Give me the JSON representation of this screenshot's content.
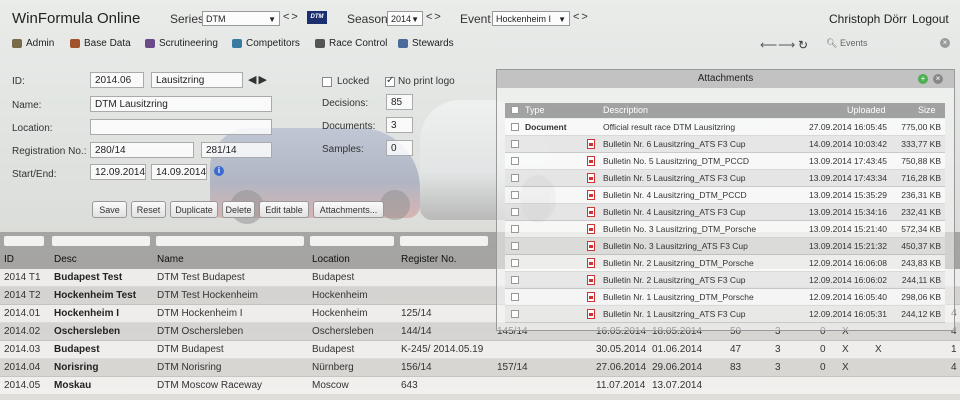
{
  "app": {
    "title": "WinFormula Online"
  },
  "header": {
    "series_label": "Series",
    "series_value": "DTM",
    "season_label": "Season",
    "season_value": "2014",
    "event_label": "Event",
    "event_value": "Hockenheim I",
    "logo_text": "DTM",
    "user": "Christoph Dörr",
    "logout": "Logout"
  },
  "menu": [
    {
      "label": "Admin",
      "icon": "admin-icon",
      "color": "#7a6a4a"
    },
    {
      "label": "Base Data",
      "icon": "base-data-icon",
      "color": "#a0522d"
    },
    {
      "label": "Scrutineering",
      "icon": "scrutineering-icon",
      "color": "#6a4a8a"
    },
    {
      "label": "Competitors",
      "icon": "competitors-icon",
      "color": "#3a7aa0"
    },
    {
      "label": "Race Control",
      "icon": "race-control-icon",
      "color": "#555555"
    },
    {
      "label": "Stewards",
      "icon": "stewards-icon",
      "color": "#4a6a9a"
    }
  ],
  "search": {
    "placeholder": "Events"
  },
  "form": {
    "id_label": "ID:",
    "id_value": "2014.06",
    "id_name": "Lausitzring",
    "name_label": "Name:",
    "name_value": "DTM Lausitzring",
    "location_label": "Location:",
    "location_value": "",
    "regno_label": "Registration No.:",
    "regno_value": "280/14",
    "regno_value2": "281/14",
    "startend_label": "Start/End:",
    "start_value": "12.09.2014",
    "end_value": "14.09.2014",
    "locked_label": "Locked",
    "noprint_label": "No print logo",
    "decisions_label": "Decisions:",
    "decisions_value": "85",
    "documents_label": "Documents:",
    "documents_value": "3",
    "samples_label": "Samples:",
    "samples_value": "0"
  },
  "buttons": {
    "save": "Save",
    "reset": "Reset",
    "duplicate": "Duplicate",
    "delete": "Delete",
    "edit_table": "Edit table",
    "attachments": "Attachments..."
  },
  "table": {
    "headers": [
      "ID",
      "Desc",
      "Name",
      "Location",
      "Register No."
    ],
    "rows": [
      {
        "id": "2014 T1",
        "desc": "Budapest Test",
        "name": "DTM Test Budapest",
        "location": "Budapest",
        "reg": "",
        "reg2": "",
        "start": "",
        "end": "",
        "n1": "",
        "n2": "",
        "n3": "",
        "x1": "",
        "x2": "",
        "last": ""
      },
      {
        "id": "2014 T2",
        "desc": "Hockenheim Test",
        "name": "DTM Test Hockenheim",
        "location": "Hockenheim",
        "reg": "",
        "reg2": "",
        "start": "",
        "end": "",
        "n1": "",
        "n2": "",
        "n3": "",
        "x1": "",
        "x2": "",
        "last": ""
      },
      {
        "id": "2014.01",
        "desc": "Hockenheim I",
        "name": "DTM Hockenheim I",
        "location": "Hockenheim",
        "reg": "125/14",
        "reg2": "",
        "start": "",
        "end": "",
        "n1": "",
        "n2": "",
        "n3": "",
        "x1": "",
        "x2": "",
        "last": "4"
      },
      {
        "id": "2014.02",
        "desc": "Oschersleben",
        "name": "DTM Oschersleben",
        "location": "Oschersleben",
        "reg": "144/14",
        "reg2": "145/14",
        "start": "16.05.2014",
        "end": "18.05.2014",
        "n1": "50",
        "n2": "3",
        "n3": "0",
        "x1": "X",
        "x2": "",
        "last": "4"
      },
      {
        "id": "2014.03",
        "desc": "Budapest",
        "name": "DTM Budapest",
        "location": "Budapest",
        "reg": "K-245/ 2014.05.19",
        "reg2": "",
        "start": "30.05.2014",
        "end": "01.06.2014",
        "n1": "47",
        "n2": "3",
        "n3": "0",
        "x1": "X",
        "x2": "X",
        "last": "1"
      },
      {
        "id": "2014.04",
        "desc": "Norisring",
        "name": "DTM Norisring",
        "location": "Nürnberg",
        "reg": "156/14",
        "reg2": "157/14",
        "start": "27.06.2014",
        "end": "29.06.2014",
        "n1": "83",
        "n2": "3",
        "n3": "0",
        "x1": "X",
        "x2": "",
        "last": "4"
      },
      {
        "id": "2014.05",
        "desc": "Moskau",
        "name": "DTM Moscow Raceway",
        "location": "Moscow",
        "reg": "643",
        "reg2": "",
        "start": "11.07.2014",
        "end": "13.07.2014",
        "n1": "",
        "n2": "",
        "n3": "",
        "x1": "",
        "x2": "",
        "last": ""
      }
    ]
  },
  "attachments": {
    "title": "Attachments",
    "headers": [
      "Type",
      "Description",
      "Uploaded",
      "Size"
    ],
    "rows": [
      {
        "type": "Document",
        "desc": "Official result race DTM Lausitzring",
        "date": "27.09.2014 16:05:45",
        "size": "775,00 KB",
        "pdf": false
      },
      {
        "type": "",
        "desc": "Bulletin Nr. 6 Lausitzring_ATS F3 Cup",
        "date": "14.09.2014 10:03:42",
        "size": "333,77 KB",
        "pdf": true
      },
      {
        "type": "",
        "desc": "Bulletin No. 5 Lausitzring_DTM_PCCD",
        "date": "13.09.2014 17:43:45",
        "size": "750,88 KB",
        "pdf": true
      },
      {
        "type": "",
        "desc": "Bulletin Nr. 5 Lausitzring_ATS F3 Cup",
        "date": "13.09.2014 17:43:34",
        "size": "716,28 KB",
        "pdf": true
      },
      {
        "type": "",
        "desc": "Bulletin Nr. 4 Lausitzring_DTM_PCCD",
        "date": "13.09.2014 15:35:29",
        "size": "236,31 KB",
        "pdf": true
      },
      {
        "type": "",
        "desc": "Bulletin Nr. 4 Lausitzring_ATS F3 Cup",
        "date": "13.09.2014 15:34:16",
        "size": "232,41 KB",
        "pdf": true
      },
      {
        "type": "",
        "desc": "Bulletin No. 3 Lausitzring_DTM_Porsche",
        "date": "13.09.2014 15:21:40",
        "size": "572,34 KB",
        "pdf": true
      },
      {
        "type": "",
        "desc": "Bulletin No. 3 Lausitzring_ATS F3 Cup",
        "date": "13.09.2014 15:21:32",
        "size": "450,37 KB",
        "pdf": true
      },
      {
        "type": "",
        "desc": "Bulletin Nr. 2 Lausitzring_DTM_Porsche",
        "date": "12.09.2014 16:06:08",
        "size": "243,83 KB",
        "pdf": true
      },
      {
        "type": "",
        "desc": "Bulletin Nr. 2 Lausitzring_ATS F3 Cup",
        "date": "12.09.2014 16:06:02",
        "size": "244,11 KB",
        "pdf": true
      },
      {
        "type": "",
        "desc": "Bulletin Nr. 1 Lausitzring_DTM_Porsche",
        "date": "12.09.2014 16:05:40",
        "size": "298,06 KB",
        "pdf": true
      },
      {
        "type": "",
        "desc": "Bulletin Nr. 1 Lausitzring_ATS F3 Cup",
        "date": "12.09.2014 16:05:31",
        "size": "244,12 KB",
        "pdf": true
      }
    ]
  },
  "colors": {
    "accent_add": "#4caf50",
    "close": "#888888",
    "info": "#3b6bd0"
  }
}
